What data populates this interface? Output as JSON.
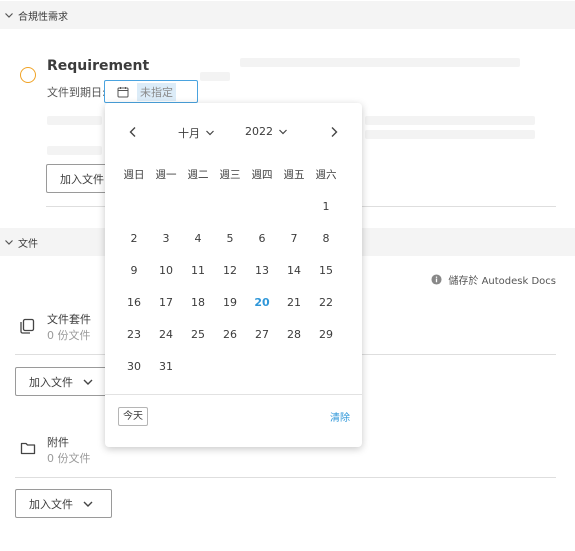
{
  "requirements_section": {
    "title": "合規性需求"
  },
  "requirement": {
    "title": "Requirement",
    "due_label": "文件到期日:",
    "date_value": "未指定",
    "add_files_button": "加入文件"
  },
  "files_section": {
    "title": "文件",
    "storage_label": "儲存於 Autodesk Docs",
    "items": [
      {
        "title": "文件套件",
        "subtitle": "0 份文件",
        "add_button": "加入文件"
      },
      {
        "title": "附件",
        "subtitle": "0 份文件",
        "add_button": "加入文件"
      }
    ]
  },
  "calendar": {
    "month": "十月",
    "year": "2022",
    "weekdays": [
      "週日",
      "週一",
      "週二",
      "週三",
      "週四",
      "週五",
      "週六"
    ],
    "weeks": [
      [
        "",
        "",
        "",
        "",
        "",
        "",
        "1"
      ],
      [
        "2",
        "3",
        "4",
        "5",
        "6",
        "7",
        "8"
      ],
      [
        "9",
        "10",
        "11",
        "12",
        "13",
        "14",
        "15"
      ],
      [
        "16",
        "17",
        "18",
        "19",
        "20",
        "21",
        "22"
      ],
      [
        "23",
        "24",
        "25",
        "26",
        "27",
        "28",
        "29"
      ],
      [
        "30",
        "31",
        "",
        "",
        "",
        "",
        ""
      ]
    ],
    "highlighted_day": "20",
    "today_button": "今天",
    "clear_button": "清除"
  },
  "colors": {
    "accent": "#2f97d9",
    "status_circle": "#f0a326",
    "section_header_bg": "#f4f4f4"
  }
}
